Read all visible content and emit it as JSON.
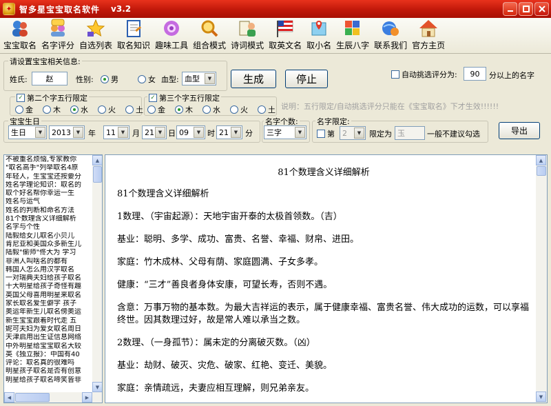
{
  "window": {
    "title": "智多星宝宝取名软件",
    "version": "v3.2"
  },
  "toolbar": [
    {
      "label": "宝宝取名",
      "icon": "people-icon"
    },
    {
      "label": "名字评分",
      "icon": "chat-people-icon"
    },
    {
      "label": "自选列表",
      "icon": "star-icon"
    },
    {
      "label": "取名知识",
      "icon": "notebook-icon"
    },
    {
      "label": "趣味工具",
      "icon": "flower-gear-icon"
    },
    {
      "label": "组合模式",
      "icon": "magnifier-icon"
    },
    {
      "label": "诗词模式",
      "icon": "poem-scroll-icon"
    },
    {
      "label": "取英文名",
      "icon": "flag-icon"
    },
    {
      "label": "取小名",
      "icon": "map-pin-icon"
    },
    {
      "label": "生辰八字",
      "icon": "pinwheel-icon"
    },
    {
      "label": "联系我们",
      "icon": "phone-globe-icon"
    },
    {
      "label": "官方主页",
      "icon": "house-icon"
    }
  ],
  "info": {
    "group_title": "请设置宝宝相关信息:",
    "surname_label": "姓氏:",
    "surname_value": "赵",
    "gender_label": "性别:",
    "gender_male": "男",
    "gender_female": "女",
    "blood_label": "血型:",
    "blood_value": "血型",
    "generate_button": "生成",
    "stop_button": "停止",
    "auto_pick_label": "自动挑选评分为:",
    "auto_pick_value": "90",
    "auto_pick_suffix": "分以上的名字",
    "second_char_title": "第二个字五行限定",
    "third_char_title": "第三个字五行限定",
    "elements": [
      "金",
      "木",
      "水",
      "火",
      "土"
    ],
    "hint": "说明：五行限定/自动挑选评分只能在《宝宝取名》下才生效!!!!!!"
  },
  "birth": {
    "group_title": "宝宝生日",
    "calendar": "生日",
    "year": "2013",
    "year_unit": "年",
    "month": "11",
    "month_unit": "月",
    "day": "21",
    "day_unit": "日",
    "hour": "09",
    "hour_unit": "时",
    "minute": "21",
    "minute_unit": "分"
  },
  "name_count": {
    "label": "名字个数:",
    "value": "三字"
  },
  "name_limit": {
    "label": "名字限定:",
    "nth_label": "第",
    "nth_value": "2",
    "limit_label": "限定为",
    "limit_value": "玉",
    "note": "一般不建议勾选"
  },
  "export_button": "导出",
  "knowledge_list": [
    "不被重名烦恼,专家教你",
    "\"取名高手\"列举取名4原",
    "年轻人，生宝宝还按要分",
    "姓名学理论知识：取名的",
    "取个好名帮你幸运一生",
    "姓名与运气",
    "姓名的判断和命名方法",
    "81个数理含义详细解析",
    "名字与个性",
    "陆毅给女儿取名小贝儿",
    "肯尼亚和美国众多新生儿",
    "陆毅\"偷师\"佟大为 学习",
    "非洲人叫啥名的都有",
    "韩国人怎么用汉字取名",
    "一对瑞典夫妇给孩子取名",
    "十大明星给孩子奇怪有趣",
    "英国父母喜用明星来取名",
    "家长取名爱生僻字 孩子",
    "奥运年新生儿取名傍奥运",
    "新生宝宝跟着时代走 五",
    "妮可夫妇为爱女取名周日",
    "天津启用出生证信息网络",
    "中外明星给宝宝取名大较",
    "英《独立报》：中国有40",
    "评论：取名真的很难吗",
    "明星孩子取名是否有创意",
    "明星给孩子取名啼笑皆非"
  ],
  "document": {
    "title": "81个数理含义详细解析",
    "paragraphs": [
      "81个数理含义详细解析",
      "1数理、（宇宙起源）：天地宇宙开泰的太极首领数。（吉）",
      "基业：聪明、多学、成功、富贵、名誉、幸福、财帛、进田。",
      "家庭：竹木成林、父母有荫、家庭圆满、子女多孝。",
      "健康：“三才”善良者身体安康，可望长寿，否则不遇。",
      "含意：万事万物的基本数。为最大吉祥运的表示，属于健康幸福、富贵名誉、伟大成功的运数，可以享福终世。因其数理过好，故是常人难以承当之数。",
      "2数理、（一身孤节）：属未定的分离破灭数。（凶）",
      "基业：劫财、破灭、灾危、破家、红艳、变迁、美貌。",
      "家庭：亲情疏远，夫妻应相互理解，则兄弟亲友。"
    ]
  },
  "colors": {
    "titlebar": "#c0180a",
    "window_bg": "#ece9d8",
    "field_border": "#7f9db9"
  }
}
